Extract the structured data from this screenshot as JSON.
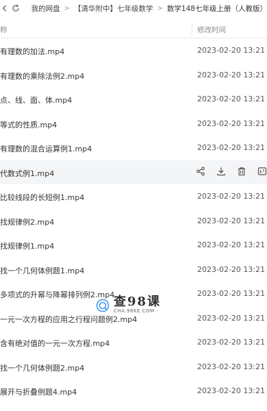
{
  "breadcrumb": {
    "items": [
      "我的网盘",
      "【清华附中】七年级数学",
      "数学148七年级上册（人教版）"
    ],
    "separator": ">"
  },
  "header": {
    "name_col": "称",
    "time_col": "修改时间"
  },
  "files": [
    {
      "name": "有理数的加法.mp4",
      "time": "2023-02-20 13:21"
    },
    {
      "name": "有理数的乘除法例2.mp4",
      "time": "2023-02-20 13:21"
    },
    {
      "name": "点、线、面、体.mp4",
      "time": "2023-02-20 13:21"
    },
    {
      "name": "等式的性质.mp4",
      "time": "2023-02-20 13:21"
    },
    {
      "name": "有理数的混合运算例1.mp4",
      "time": "2023-02-20 13:21"
    },
    {
      "name": "代数式例1.mp4",
      "time": "",
      "hover": true
    },
    {
      "name": "比较线段的长短例1.mp4",
      "time": "2023-02-20 13:21"
    },
    {
      "name": "找规律例2.mp4",
      "time": "2023-02-20 13:21"
    },
    {
      "name": "找规律例1.mp4",
      "time": "2023-02-20 13:21"
    },
    {
      "name": "找一个几何体例题1.mp4",
      "time": "2023-02-20 13:21"
    },
    {
      "name": "多项式的升幂与降幂排列例2.mp4",
      "time": "2023-02-20 13:21"
    },
    {
      "name": "一元一次方程的应用之行程问题例2.mp4",
      "time": "2023-02-20 13:21"
    },
    {
      "name": "含有绝对值的一元一次方程.mp4",
      "time": "2023-02-20 13:21"
    },
    {
      "name": "找一个几何体例题2.mp4",
      "time": "2023-02-20 13:21"
    },
    {
      "name": "展开与折叠例题4.mp4",
      "time": "2023-02-20 13:21"
    }
  ],
  "row_actions": [
    "share-icon",
    "download-icon",
    "delete-icon",
    "more-icon"
  ],
  "watermark": {
    "title": "查98课",
    "url": "CHA.98KE.COM"
  },
  "colors": {
    "hover_row": "#f4f5f7",
    "watermark_blue": "#2b8ef0"
  }
}
